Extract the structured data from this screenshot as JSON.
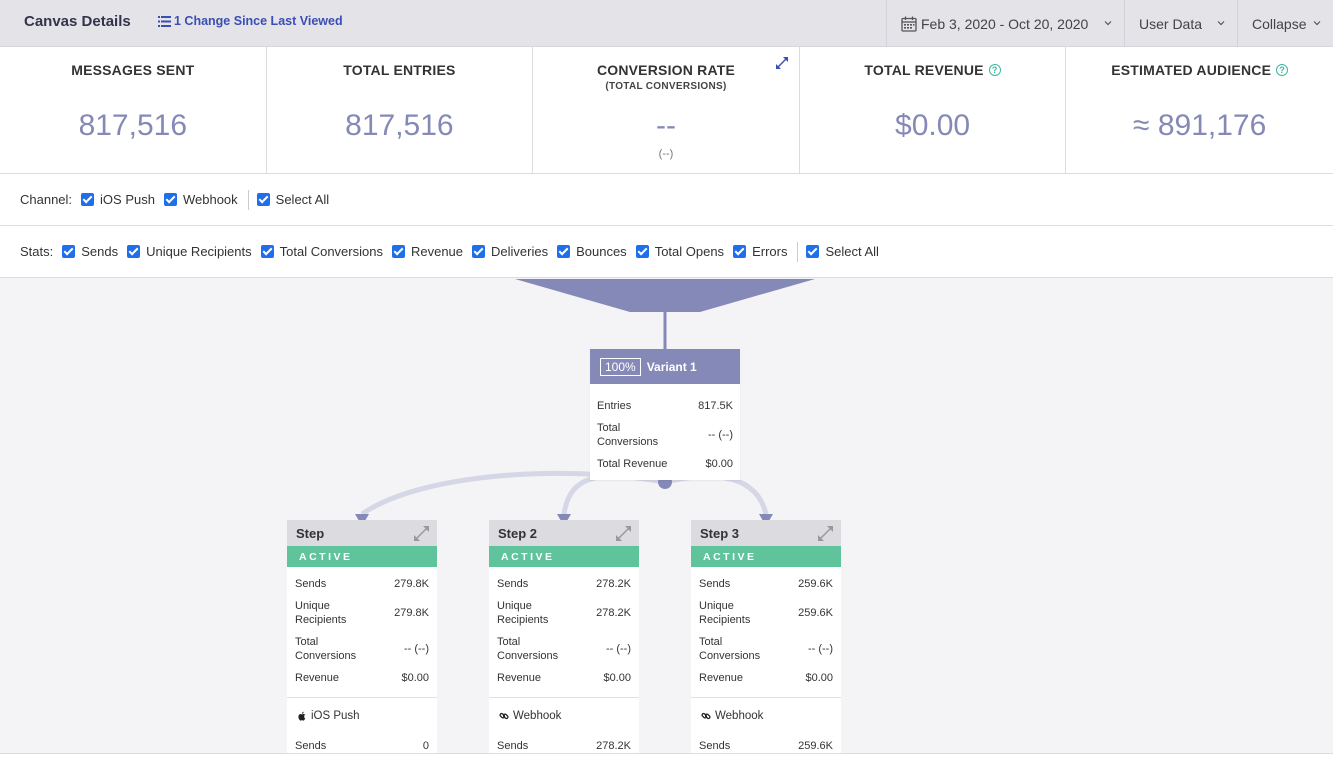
{
  "header": {
    "title": "Canvas Details",
    "changes": "1 Change Since Last Viewed",
    "date_range": "Feb 3, 2020 - Oct 20, 2020",
    "user_data": "User Data",
    "collapse": "Collapse"
  },
  "stats": [
    {
      "label": "MESSAGES SENT",
      "sub": "",
      "value": "817,516",
      "value2": ""
    },
    {
      "label": "TOTAL ENTRIES",
      "sub": "",
      "value": "817,516",
      "value2": ""
    },
    {
      "label": "CONVERSION RATE",
      "sub": "(TOTAL CONVERSIONS)",
      "value": "--",
      "value2": "(--)"
    },
    {
      "label": "TOTAL REVENUE",
      "sub": "",
      "value": "$0.00",
      "value2": ""
    },
    {
      "label": "ESTIMATED AUDIENCE",
      "sub": "",
      "value": "≈ 891,176",
      "value2": ""
    }
  ],
  "channel_filter": {
    "label": "Channel:",
    "options": [
      "iOS Push",
      "Webhook",
      "Select All"
    ]
  },
  "stats_filter": {
    "label": "Stats:",
    "options": [
      "Sends",
      "Unique Recipients",
      "Total Conversions",
      "Revenue",
      "Deliveries",
      "Bounces",
      "Total Opens",
      "Errors",
      "Select All"
    ]
  },
  "variant": {
    "pct": "100%",
    "name": "Variant 1",
    "rows": [
      {
        "k": "Entries",
        "v": "817.5K"
      },
      {
        "k": "Total Conversions",
        "v": "-- (--)"
      },
      {
        "k": "Total Revenue",
        "v": "$0.00"
      }
    ]
  },
  "steps": [
    {
      "name": "Step",
      "status": "ACTIVE",
      "rows": [
        {
          "k": "Sends",
          "v": "279.8K"
        },
        {
          "k": "Unique Recipients",
          "v": "279.8K"
        },
        {
          "k": "Total Conversions",
          "v": "-- (--)"
        },
        {
          "k": "Revenue",
          "v": "$0.00"
        }
      ],
      "channel": "iOS Push",
      "channel_icon": "apple-icon",
      "channel_sends_label": "Sends",
      "channel_sends_value": "0"
    },
    {
      "name": "Step 2",
      "status": "ACTIVE",
      "rows": [
        {
          "k": "Sends",
          "v": "278.2K"
        },
        {
          "k": "Unique Recipients",
          "v": "278.2K"
        },
        {
          "k": "Total Conversions",
          "v": "-- (--)"
        },
        {
          "k": "Revenue",
          "v": "$0.00"
        }
      ],
      "channel": "Webhook",
      "channel_icon": "link-icon",
      "channel_sends_label": "Sends",
      "channel_sends_value": "278.2K"
    },
    {
      "name": "Step 3",
      "status": "ACTIVE",
      "rows": [
        {
          "k": "Sends",
          "v": "259.6K"
        },
        {
          "k": "Unique Recipients",
          "v": "259.6K"
        },
        {
          "k": "Total Conversions",
          "v": "-- (--)"
        },
        {
          "k": "Revenue",
          "v": "$0.00"
        }
      ],
      "channel": "Webhook",
      "channel_icon": "link-icon",
      "channel_sends_label": "Sends",
      "channel_sends_value": "259.6K"
    }
  ],
  "colors": {
    "accent": "#8589b8",
    "active": "#5fc49c",
    "link": "#3a4fb5",
    "checkbox": "#1f6feb"
  }
}
